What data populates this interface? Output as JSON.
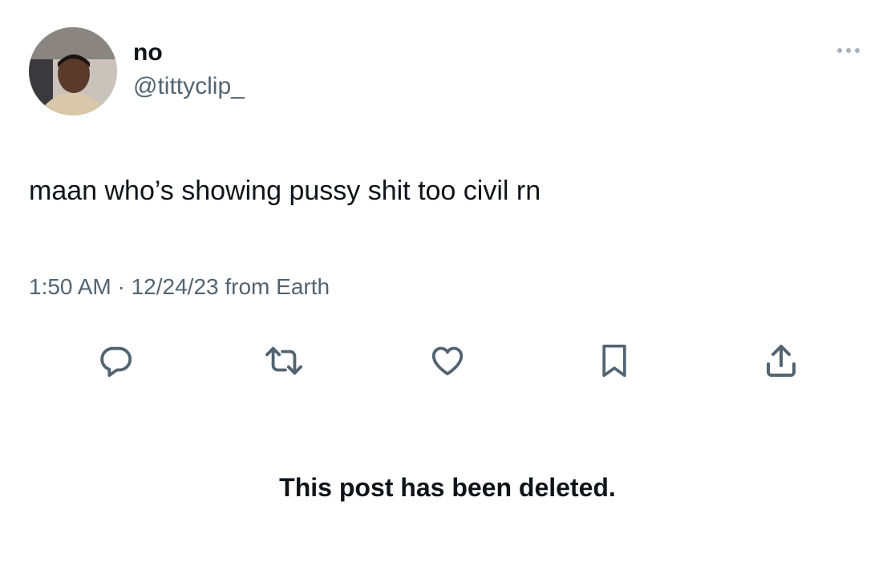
{
  "author": {
    "display_name": "no",
    "handle": "@tittyclip_",
    "avatar_icon": "profile-photo"
  },
  "tweet": {
    "text": "maan who’s showing pussy shit too civil rn",
    "timestamp": "1:50 AM · 12/24/23 from Earth"
  },
  "actions": [
    {
      "name": "reply",
      "icon": "reply-icon"
    },
    {
      "name": "retweet",
      "icon": "retweet-icon"
    },
    {
      "name": "like",
      "icon": "heart-icon"
    },
    {
      "name": "bookmark",
      "icon": "bookmark-icon"
    },
    {
      "name": "share",
      "icon": "share-icon"
    }
  ],
  "notice": "This post has been deleted.",
  "colors": {
    "text_primary": "#0f1419",
    "text_secondary": "#536471",
    "icon": "#536471",
    "background": "#ffffff"
  }
}
